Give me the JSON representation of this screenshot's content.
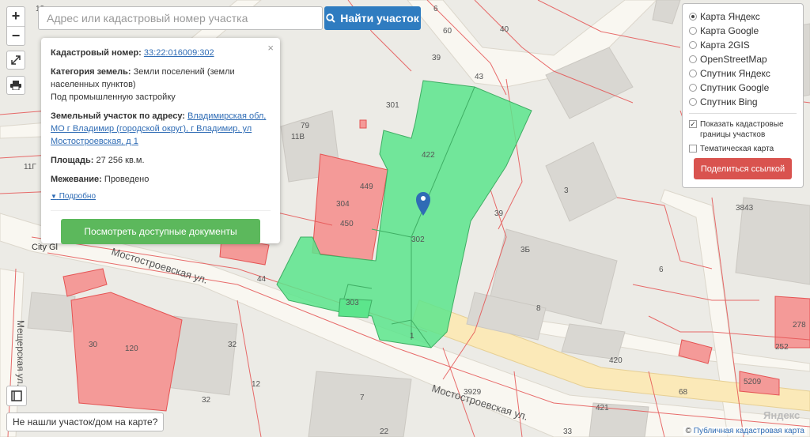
{
  "search": {
    "placeholder": "Адрес или кадастровый номер участка",
    "button_label": "Найти участок"
  },
  "zoom": {
    "in_label": "+",
    "out_label": "−"
  },
  "popup": {
    "cadastral_label": "Кадастровый номер:",
    "cadastral_value": "33:22:016009:302",
    "category_label": "Категория земель:",
    "category_value": "Земли поселений (земли населенных пунктов)",
    "use_value": "Под промышленную застройку",
    "address_label": "Земельный участок по адресу:",
    "address_value": "Владимирская обл, МО г Владимир (городской округ), г Владимир, ул Мостостроевская, д 1",
    "area_label": "Площадь:",
    "area_value": "27 256 кв.м.",
    "survey_label": "Межевание:",
    "survey_value": "Проведено",
    "more_label": "Подробно",
    "docs_button": "Посмотреть доступные документы",
    "close_glyph": "×"
  },
  "layers": {
    "options": [
      {
        "label": "Карта Яндекс",
        "selected": true
      },
      {
        "label": "Карта Google",
        "selected": false
      },
      {
        "label": "Карта 2GIS",
        "selected": false
      },
      {
        "label": "OpenStreetMap",
        "selected": false
      },
      {
        "label": "Спутник Яндекс",
        "selected": false
      },
      {
        "label": "Спутник Google",
        "selected": false
      },
      {
        "label": "Спутник Bing",
        "selected": false
      }
    ],
    "show_borders_label": "Показать кадастровые границы участков",
    "show_borders_checked": true,
    "thematic_label": "Тематическая карта",
    "thematic_checked": false,
    "share_button": "Поделиться ссылкой"
  },
  "map": {
    "street_labels": [
      "Мостостроевская ул.",
      "Мостостроевская ул.",
      "Мещерская ул."
    ],
    "building_labels": [
      "301",
      "79",
      "11В",
      "422",
      "449",
      "304",
      "450",
      "302",
      "303",
      "1",
      "3",
      "3Б",
      "8",
      "6",
      "420",
      "421",
      "3929",
      "7",
      "22",
      "30",
      "120",
      "32",
      "32",
      "12",
      "44",
      "60",
      "40",
      "43",
      "39",
      "39",
      "6",
      "11Г",
      "68",
      "252",
      "278",
      "5209",
      "3843",
      "33",
      "13"
    ],
    "poi_label": "City Gl",
    "colors": {
      "selected_parcel": "#5ce58c",
      "parcel_fill": "#f08f8f",
      "parcel_border": "#e55353",
      "road": "#f7f5ef",
      "building": "#d8d6d1"
    }
  },
  "footer": {
    "not_found": "Не нашли участок/дом на карте?",
    "attribution_prefix": "©",
    "attribution_link": "Публичная кадастровая карта",
    "yandex_mark": "Яндекс"
  }
}
